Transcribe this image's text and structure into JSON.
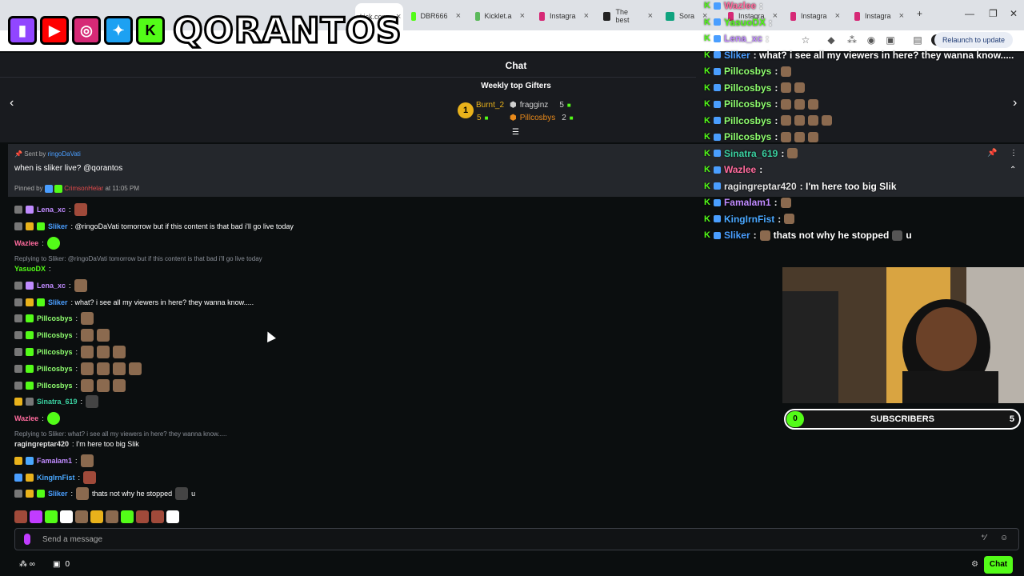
{
  "browser": {
    "tabs": [
      {
        "label": "kick.com",
        "icon": "kick-icon",
        "color": "#53fc18",
        "active": true
      },
      {
        "label": "DBR666",
        "icon": "kick-icon",
        "color": "#53fc18"
      },
      {
        "label": "Kicklet.a",
        "icon": "kicklet-icon",
        "color": "#5bb95b"
      },
      {
        "label": "Instagra",
        "icon": "instagram-icon",
        "color": "#d62976"
      },
      {
        "label": "The best",
        "icon": "github-icon",
        "color": "#222222"
      },
      {
        "label": "Sora",
        "icon": "sora-icon",
        "color": "#10a37f"
      },
      {
        "label": "Instagra",
        "icon": "instagram-icon",
        "color": "#d62976"
      },
      {
        "label": "Instagra",
        "icon": "instagram-icon",
        "color": "#d62976"
      },
      {
        "label": "Instagra",
        "icon": "instagram-icon",
        "color": "#d62976"
      }
    ],
    "relaunch_label": "Relaunch to update"
  },
  "banner": {
    "brand": "QORANTOS",
    "socials": [
      "twitch-icon",
      "youtube-icon",
      "instagram-icon",
      "twitter-icon",
      "kick-icon"
    ]
  },
  "chat": {
    "title": "Chat",
    "weekly_title": "Weekly top Gifters",
    "gifters": [
      {
        "rank": "1",
        "name": "Burnt_2",
        "count": "5",
        "color": "#e9b21b"
      },
      {
        "name": "fragginz",
        "count": "5",
        "color": "#cfcfcf"
      },
      {
        "name": "Pillcosbys",
        "count": "2",
        "color": "#e98a1b"
      }
    ],
    "pinned": {
      "sent_by_prefix": "Sent by",
      "sent_by": "ringoDaVati",
      "message": "when is sliker live? @qorantos",
      "pinned_by_prefix": "Pinned by",
      "pinned_by": "CrimsonHelar",
      "time": "at 11:05 PM"
    },
    "messages": [
      {
        "user": "Lena_xc",
        "color": "#c08bff",
        "text": ":",
        "emote": "red",
        "reply": ""
      },
      {
        "user": "Sliker",
        "color": "#4a9eff",
        "text": ": @ringoDaVati tomorrow but if this content is that bad i'll go live today",
        "emote": "",
        "reply": ""
      },
      {
        "user": "Wazlee",
        "color": "#ff6b9d",
        "text": ":",
        "emote": "green",
        "reply": ""
      },
      {
        "user": "YasuoDX",
        "color": "#53fc18",
        "text": ":",
        "emote": "",
        "reply": "Replying to Sliker: @ringoDaVati tomorrow but if this content is that bad i'll go live today"
      },
      {
        "user": "Lena_xc",
        "color": "#c08bff",
        "text": ":",
        "emote": "brown",
        "reply": ""
      },
      {
        "user": "Sliker",
        "color": "#4a9eff",
        "text": ": what? i see all my viewers in here? they wanna know.....",
        "emote": "",
        "reply": ""
      },
      {
        "user": "Pillcosbys",
        "color": "#8fff6f",
        "text": ":",
        "emote": "brown1",
        "reply": ""
      },
      {
        "user": "Pillcosbys",
        "color": "#8fff6f",
        "text": ":",
        "emote": "brown2",
        "reply": ""
      },
      {
        "user": "Pillcosbys",
        "color": "#8fff6f",
        "text": ":",
        "emote": "brown3",
        "reply": ""
      },
      {
        "user": "Pillcosbys",
        "color": "#8fff6f",
        "text": ":",
        "emote": "brown4",
        "reply": ""
      },
      {
        "user": "Pillcosbys",
        "color": "#8fff6f",
        "text": ":",
        "emote": "brown3",
        "reply": ""
      },
      {
        "user": "Sinatra_619",
        "color": "#3ad0a0",
        "text": ":",
        "emote": "dark",
        "reply": ""
      },
      {
        "user": "Wazlee",
        "color": "#ff6b9d",
        "text": ":",
        "emote": "green",
        "reply": ""
      },
      {
        "user": "ragingreptar420",
        "color": "#e3e3e3",
        "text": ": I'm here too big Slik",
        "emote": "",
        "reply": "Replying to Sliker: what? i see all my viewers in here? they wanna know....."
      },
      {
        "user": "Famalam1",
        "color": "#c08bff",
        "text": ":",
        "emote": "brown",
        "reply": ""
      },
      {
        "user": "KingIrnFist",
        "color": "#4aa8ff",
        "text": ":",
        "emote": "red",
        "reply": ""
      },
      {
        "user": "Sliker",
        "color": "#4a9eff",
        "text": ":",
        "emote": "",
        "after": "thats not why he stopped",
        "tail": "u",
        "reply": ""
      }
    ],
    "input_placeholder": "Send a message",
    "viewer_count": "0",
    "send_label": "Chat"
  },
  "overlay": {
    "lines": [
      {
        "user": "Wazlee",
        "color": "#ff6b9d",
        "text": ":",
        "emotes": 0
      },
      {
        "user": "YasuoDX",
        "color": "#53fc18",
        "text": ":",
        "emotes": 0
      },
      {
        "user": "Lena_xc",
        "color": "#c08bff",
        "text": ":",
        "emotes": 0
      },
      {
        "user": "Sliker",
        "color": "#4a9eff",
        "text": ": what? i see all my viewers in here? they wanna know.....",
        "emotes": 0
      },
      {
        "user": "Pillcosbys",
        "color": "#8fff6f",
        "text": ":",
        "emotes": 1
      },
      {
        "user": "Pillcosbys",
        "color": "#8fff6f",
        "text": ":",
        "emotes": 2
      },
      {
        "user": "Pillcosbys",
        "color": "#8fff6f",
        "text": ":",
        "emotes": 3
      },
      {
        "user": "Pillcosbys",
        "color": "#8fff6f",
        "text": ":",
        "emotes": 4
      },
      {
        "user": "Pillcosbys",
        "color": "#8fff6f",
        "text": ":",
        "emotes": 3
      },
      {
        "user": "Sinatra_619",
        "color": "#3ad0a0",
        "text": ":",
        "emotes": 1
      },
      {
        "user": "Wazlee",
        "color": "#ff6b9d",
        "text": ":",
        "emotes": 0
      },
      {
        "user": "ragingreptar420",
        "color": "#e3e3e3",
        "text": ": I'm here too big Slik",
        "emotes": 0
      },
      {
        "user": "Famalam1",
        "color": "#c08bff",
        "text": ":",
        "emotes": 1
      },
      {
        "user": "KingIrnFist",
        "color": "#4aa8ff",
        "text": ":",
        "emotes": 1
      },
      {
        "user": "Sliker",
        "color": "#4a9eff",
        "text": ": ",
        "after": "thats not why he stopped",
        "tail": "u",
        "emotes": 0
      }
    ]
  },
  "subs_goal": {
    "current": "0",
    "label": "SUBSCRIBERS",
    "goal": "5",
    "progress": 0
  }
}
